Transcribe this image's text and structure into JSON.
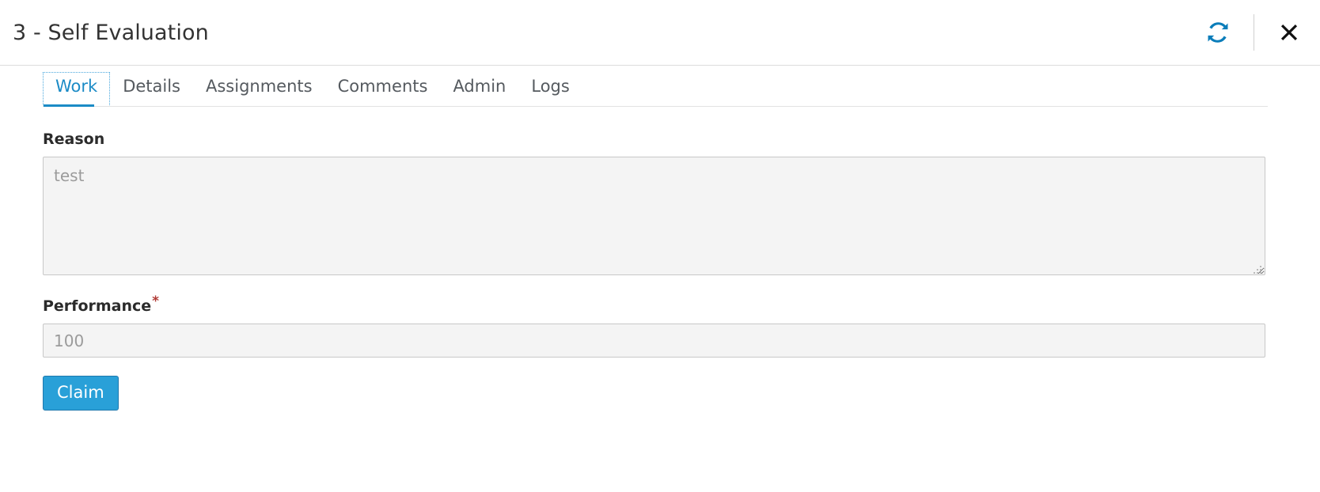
{
  "header": {
    "title": "3 - Self Evaluation",
    "refresh_icon": "refresh-icon",
    "close_icon": "close-icon",
    "accent_color": "#0b7dba"
  },
  "tabs": [
    {
      "label": "Work",
      "active": true
    },
    {
      "label": "Details",
      "active": false
    },
    {
      "label": "Assignments",
      "active": false
    },
    {
      "label": "Comments",
      "active": false
    },
    {
      "label": "Admin",
      "active": false
    },
    {
      "label": "Logs",
      "active": false
    }
  ],
  "form": {
    "reason": {
      "label": "Reason",
      "value": "",
      "placeholder": "test"
    },
    "performance": {
      "label": "Performance",
      "required_marker": "*",
      "value": "",
      "placeholder": "100"
    },
    "submit": {
      "label": "Claim",
      "color": "#29a0d8",
      "border_color": "#1f78ad"
    }
  }
}
